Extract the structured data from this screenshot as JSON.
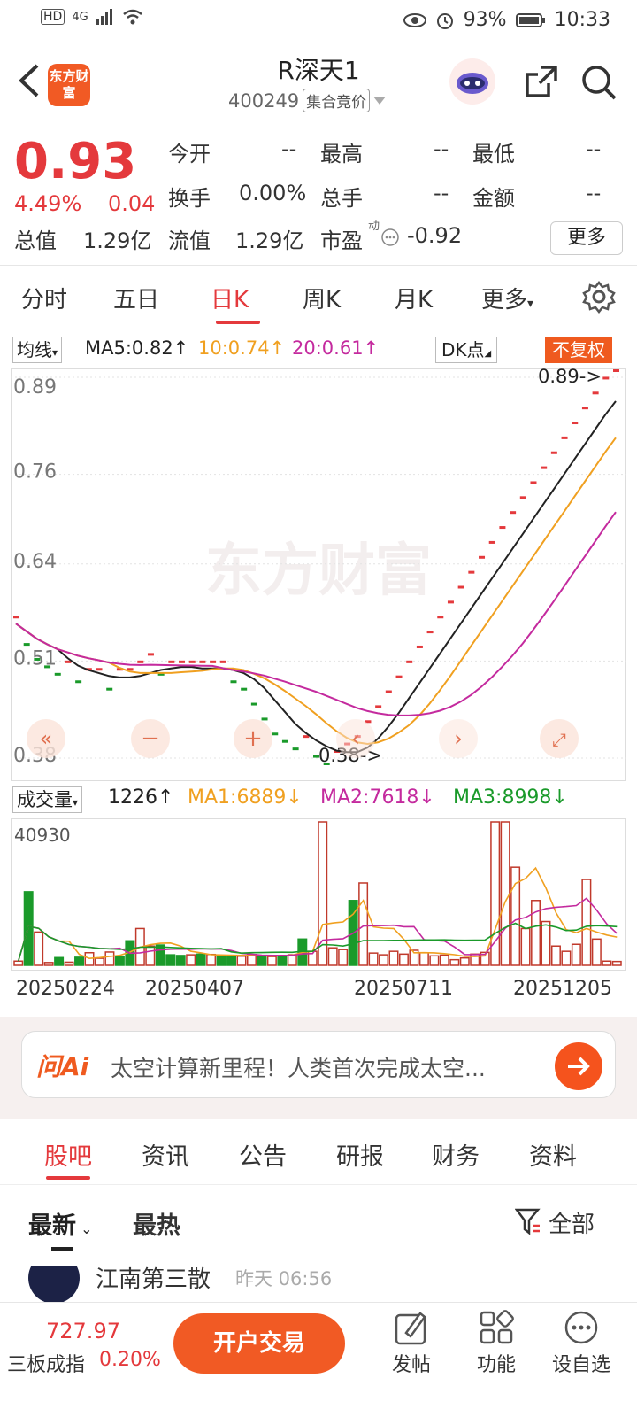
{
  "status": {
    "battery": "93%",
    "time": "10:33",
    "network": "4G"
  },
  "header": {
    "title": "R深天1",
    "code": "400249",
    "tag": "集合竞价",
    "logo_text": "东方财富"
  },
  "quote": {
    "price": "0.93",
    "change_pct": "4.49%",
    "change": "0.04",
    "fields": [
      {
        "k": "今开",
        "v": "--"
      },
      {
        "k": "最高",
        "v": "--"
      },
      {
        "k": "最低",
        "v": "--"
      },
      {
        "k": "换手",
        "v": "0.00%"
      },
      {
        "k": "总手",
        "v": "--"
      },
      {
        "k": "金额",
        "v": "--"
      },
      {
        "k": "总值",
        "v": "1.29亿"
      },
      {
        "k": "流值",
        "v": "1.29亿"
      },
      {
        "k": "市盈",
        "v": "-0.92"
      }
    ],
    "pe_sup": "动",
    "more": "更多"
  },
  "ktabs": [
    "分时",
    "五日",
    "日K",
    "周K",
    "月K",
    "更多"
  ],
  "ma": {
    "selector": "均线",
    "ma5": "MA5:0.82↑",
    "ma10": "10:0.74↑",
    "ma20": "20:0.61↑",
    "dk": "DK点",
    "fq": "不复权",
    "ma5_color": "#222222",
    "ma10_color": "#f0a020",
    "ma20_color": "#c42a9e"
  },
  "chart_data": {
    "type": "candlestick",
    "ylim": [
      0.38,
      0.89
    ],
    "y_ticks": [
      "0.89",
      "0.76",
      "0.64",
      "0.51",
      "0.38"
    ],
    "annotations": {
      "high": "0.89->",
      "low": "0.38->"
    },
    "watermark": "东方财富",
    "closes": [
      0.56,
      0.54,
      0.52,
      0.51,
      0.5,
      0.5,
      0.49,
      0.49,
      0.49,
      0.48,
      0.49,
      0.49,
      0.5,
      0.51,
      0.5,
      0.5,
      0.5,
      0.5,
      0.5,
      0.5,
      0.5,
      0.49,
      0.48,
      0.46,
      0.44,
      0.42,
      0.41,
      0.4,
      0.4,
      0.39,
      0.38,
      0.38,
      0.39,
      0.4,
      0.42,
      0.44,
      0.46,
      0.48,
      0.5,
      0.52,
      0.54,
      0.56,
      0.58,
      0.6,
      0.62,
      0.64,
      0.66,
      0.68,
      0.7,
      0.72,
      0.74,
      0.76,
      0.78,
      0.8,
      0.82,
      0.84,
      0.86,
      0.88,
      0.89
    ],
    "volume": {
      "label": "成交量",
      "value": "1226↑",
      "ma1": "MA1:6889↓",
      "ma2": "MA2:7618↓",
      "ma3": "MA3:8998↓",
      "ymax_label": "40930",
      "values": [
        1200,
        21000,
        9500,
        800,
        2200,
        900,
        2300,
        3600,
        2000,
        3800,
        2600,
        7000,
        10500,
        5500,
        5800,
        3000,
        2800,
        3000,
        3200,
        3100,
        2700,
        2500,
        2600,
        3100,
        2800,
        2500,
        2800,
        3000,
        7500,
        4000,
        40930,
        5000,
        4500,
        18500,
        23500,
        3500,
        3000,
        4000,
        3200,
        4300,
        3600,
        2700,
        2900,
        1600,
        2100,
        3200,
        3700,
        40930,
        40930,
        28000,
        10500,
        18500,
        12500,
        5500,
        4000,
        6000,
        24500,
        7500,
        1200,
        1100
      ],
      "up": [
        true,
        false,
        true,
        true,
        false,
        true,
        false,
        true,
        true,
        true,
        false,
        false,
        true,
        true,
        false,
        false,
        false,
        true,
        false,
        true,
        false,
        false,
        true,
        true,
        false,
        true,
        false,
        true,
        false,
        true,
        true,
        true,
        true,
        false,
        true,
        true,
        true,
        true,
        true,
        true,
        true,
        true,
        true,
        true,
        true,
        true,
        true,
        true,
        true,
        true,
        true,
        true,
        true,
        true,
        true,
        true,
        true,
        true,
        true,
        true
      ]
    },
    "x_dates": [
      "20250224",
      "20250407",
      "20250711",
      "20251205"
    ]
  },
  "ai": {
    "brand": "问Ai",
    "text": "太空计算新里程！人类首次完成太空..."
  },
  "btabs": [
    "股吧",
    "资讯",
    "公告",
    "研报",
    "财务",
    "资料"
  ],
  "filter": {
    "new": "最新",
    "hot": "最热",
    "all": "全部"
  },
  "post": {
    "author": "江南第三散",
    "time": "昨天 06:56"
  },
  "bottom": {
    "index_value": "727.97",
    "index_name": "三板成指",
    "index_pct": "0.20%",
    "open": "开户交易",
    "post": "发帖",
    "func": "功能",
    "watch": "设自选"
  }
}
